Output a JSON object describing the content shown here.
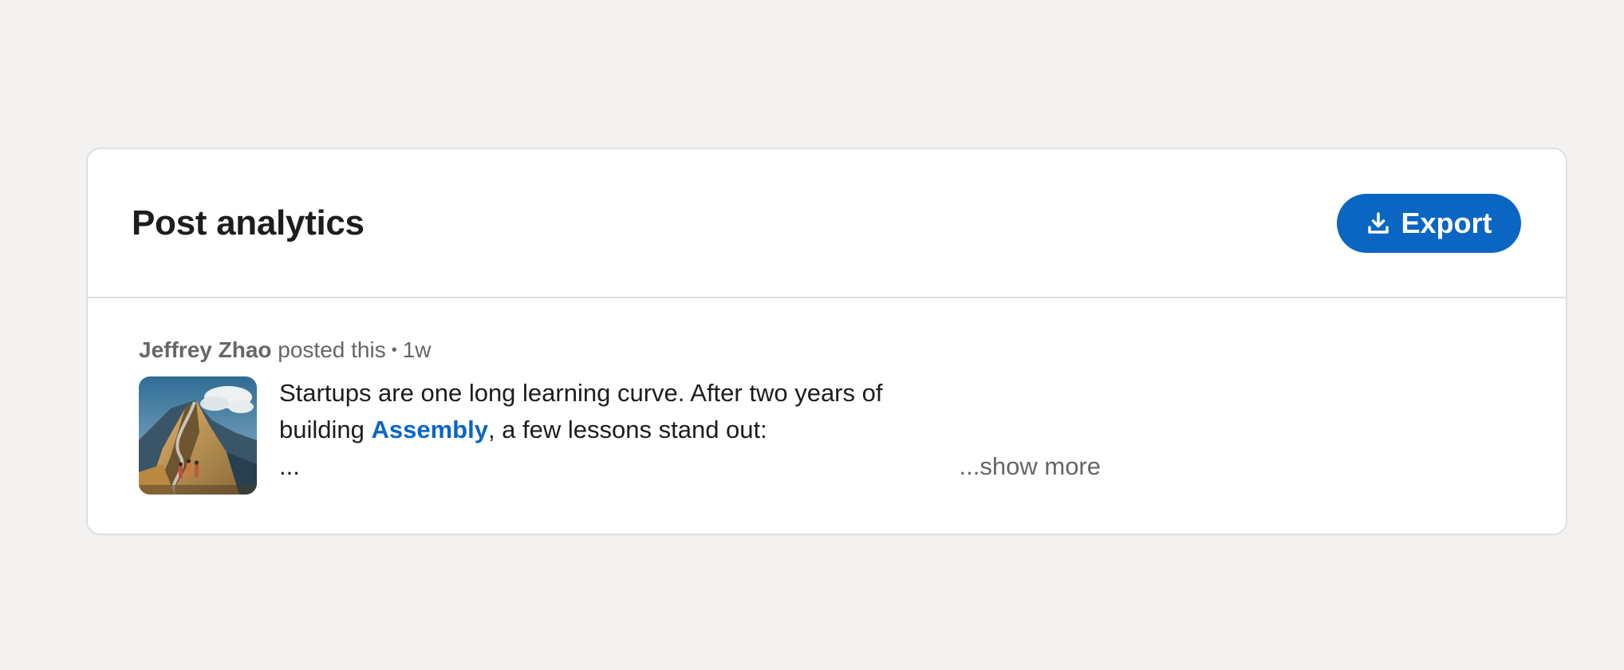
{
  "header": {
    "title": "Post analytics",
    "export_label": "Export"
  },
  "post": {
    "author": "Jeffrey Zhao",
    "action": "posted this",
    "separator": "•",
    "age": "1w",
    "text_line1": "Startups are one long learning curve. After two years of",
    "text_line2_before": "building ",
    "link_text": "Assembly",
    "text_line2_after": ", a few lessons stand out:",
    "text_line3": "...",
    "show_more": "...show more",
    "thumbnail": "mountain-climbers-painting"
  },
  "colors": {
    "background": "#f4f2f0",
    "card": "#ffffff",
    "accent": "#0a66c2",
    "muted_text": "#666666",
    "text": "#1d1d1d"
  }
}
